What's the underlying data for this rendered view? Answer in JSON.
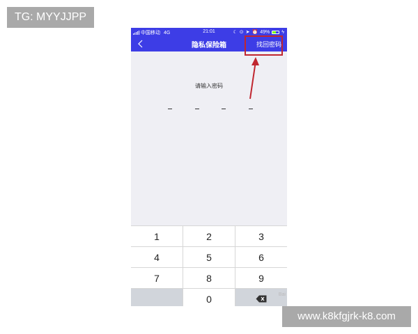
{
  "overlays": {
    "tg_label": "TG: MYYJJPP",
    "watermark": "www.k8kfgjrk-k8.com"
  },
  "status_bar": {
    "carrier": "中国移动",
    "network": "4G",
    "time": "21:01",
    "battery": "49%",
    "battery_level": 0.49
  },
  "nav": {
    "title": "隐私保险箱",
    "recover_label": "找回密码"
  },
  "pin": {
    "prompt": "请输入密码",
    "slots": 4
  },
  "keypad": {
    "keys": [
      "1",
      "2",
      "3",
      "4",
      "5",
      "6",
      "7",
      "8",
      "9",
      "",
      "0",
      ""
    ],
    "baidu_text": "Bai"
  },
  "colors": {
    "header": "#3d3de6",
    "annotation": "#c0262f",
    "background": "#efeff4"
  }
}
